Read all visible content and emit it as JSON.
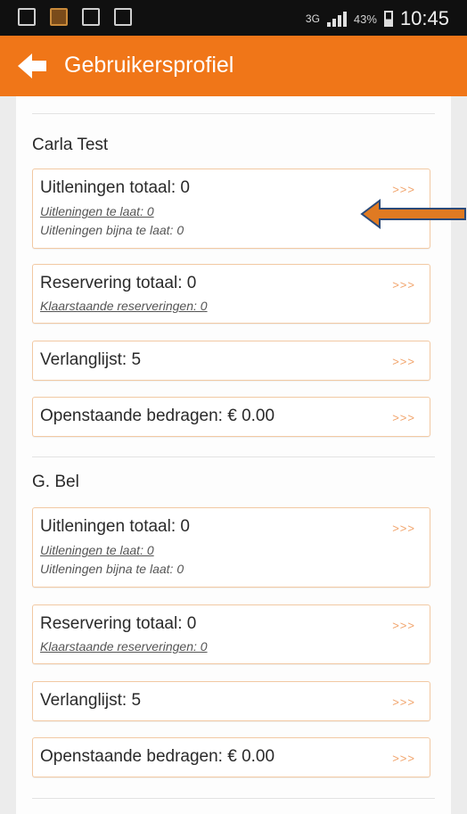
{
  "status_bar": {
    "network": "3G",
    "battery": "43%",
    "time": "10:45"
  },
  "app_bar": {
    "title": "Gebruikersprofiel"
  },
  "users": [
    {
      "name": "Carla Test",
      "cards": {
        "loans": {
          "title": "Uitleningen totaal: 0",
          "late": "Uitleningen te laat: 0",
          "almost_late": "Uitleningen bijna te laat: 0",
          "more": ">>>"
        },
        "reservations": {
          "title": "Reservering totaal: 0",
          "ready": "Klaarstaande reserveringen: 0",
          "more": ">>>"
        },
        "wishlist": {
          "title": "Verlanglijst: 5",
          "more": ">>>"
        },
        "outstanding": {
          "title": "Openstaande bedragen: € 0.00",
          "more": ">>>"
        }
      }
    },
    {
      "name": "G. Bel",
      "cards": {
        "loans": {
          "title": "Uitleningen totaal: 0",
          "late": "Uitleningen te laat: 0",
          "almost_late": "Uitleningen bijna te laat: 0",
          "more": ">>>"
        },
        "reservations": {
          "title": "Reservering totaal: 0",
          "ready": "Klaarstaande reserveringen: 0",
          "more": ">>>"
        },
        "wishlist": {
          "title": "Verlanglijst: 5",
          "more": ">>>"
        },
        "outstanding": {
          "title": "Openstaande bedragen: € 0.00",
          "more": ">>>"
        }
      }
    }
  ],
  "colors": {
    "app_bar": "#f07618",
    "status_bar": "#101010",
    "card_border": "#f2c9a3",
    "annotation_arrow": "#e07a22"
  },
  "icons": [
    "back-arrow-icon",
    "notification-icon",
    "signal-icon",
    "battery-icon"
  ]
}
